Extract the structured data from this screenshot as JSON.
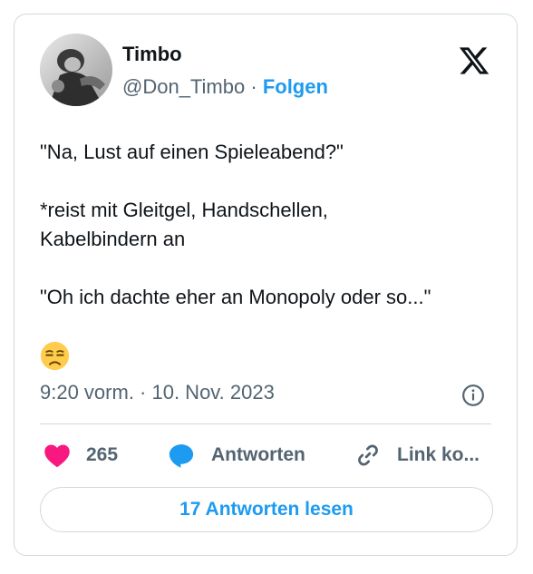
{
  "tweet": {
    "author_name": "Timbo",
    "author_handle": "@Don_Timbo",
    "separator": "·",
    "follow_label": "Folgen",
    "paragraphs": [
      "\"Na, Lust auf einen Spieleabend?\"",
      "*reist mit Gleitgel, Handschellen, Kabelbindern an",
      "\"Oh ich dachte eher an Monopoly oder so...\""
    ],
    "emoji": "unamused-face",
    "timestamp": "9:20 vorm. · 10. Nov. 2023"
  },
  "actions": {
    "like_count": "265",
    "reply_label": "Antworten",
    "copy_link_label": "Link ko..."
  },
  "read_replies_label": "17 Antworten lesen",
  "colors": {
    "accent": "#1d9bf0",
    "like": "#f91880",
    "secondary_text": "#536471",
    "border": "#cfd9de"
  },
  "icons": [
    "x-logo-icon",
    "info-icon",
    "heart-icon",
    "reply-bubble-icon",
    "link-icon"
  ]
}
